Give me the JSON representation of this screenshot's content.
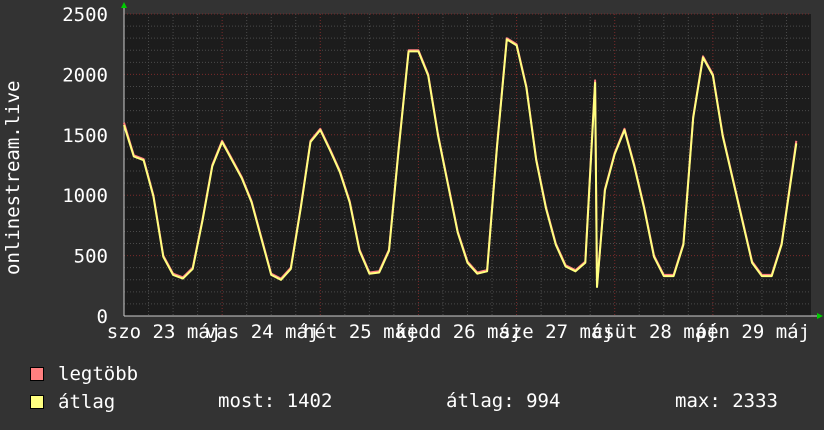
{
  "chart_data": {
    "type": "line",
    "ylabel": "onlinestream.live",
    "ylim": [
      0,
      2500
    ],
    "yticks": [
      0,
      500,
      1000,
      1500,
      2000,
      2500
    ],
    "x_tick_labels": [
      "szo 23 máj",
      "vas 24 máj",
      "hét 25 máj",
      "kedd 26 máj",
      "sze 27 máj",
      "csüt 28 máj",
      "pén 29 máj"
    ],
    "grid": true,
    "colors": {
      "background": "#333333",
      "plot": "#1c1c1c",
      "grid_major": "#7a2a2a",
      "grid_minor": "#4a4a4a",
      "max": "#ff8080",
      "avg": "#ffff80",
      "axis_arrow": "#00cc00"
    },
    "series": [
      {
        "name": "legtöbb",
        "color": "#ff8080",
        "values": [
          [
            0,
            1600
          ],
          [
            0.1,
            1330
          ],
          [
            0.2,
            1300
          ],
          [
            0.3,
            1000
          ],
          [
            0.4,
            500
          ],
          [
            0.5,
            350
          ],
          [
            0.6,
            320
          ],
          [
            0.7,
            400
          ],
          [
            0.8,
            800
          ],
          [
            0.9,
            1250
          ],
          [
            1.0,
            1450
          ],
          [
            1.1,
            1300
          ],
          [
            1.2,
            1150
          ],
          [
            1.3,
            950
          ],
          [
            1.4,
            650
          ],
          [
            1.5,
            350
          ],
          [
            1.6,
            310
          ],
          [
            1.7,
            400
          ],
          [
            1.8,
            900
          ],
          [
            1.9,
            1450
          ],
          [
            2.0,
            1550
          ],
          [
            2.1,
            1380
          ],
          [
            2.2,
            1200
          ],
          [
            2.3,
            950
          ],
          [
            2.4,
            550
          ],
          [
            2.5,
            360
          ],
          [
            2.6,
            370
          ],
          [
            2.7,
            550
          ],
          [
            2.8,
            1400
          ],
          [
            2.9,
            2200
          ],
          [
            3.0,
            2200
          ],
          [
            3.1,
            2000
          ],
          [
            3.2,
            1500
          ],
          [
            3.3,
            1100
          ],
          [
            3.4,
            700
          ],
          [
            3.5,
            450
          ],
          [
            3.6,
            360
          ],
          [
            3.7,
            380
          ],
          [
            3.8,
            1400
          ],
          [
            3.9,
            2300
          ],
          [
            4.0,
            2250
          ],
          [
            4.1,
            1900
          ],
          [
            4.2,
            1300
          ],
          [
            4.3,
            900
          ],
          [
            4.4,
            600
          ],
          [
            4.5,
            420
          ],
          [
            4.6,
            380
          ],
          [
            4.7,
            450
          ],
          [
            4.8,
            1950
          ],
          [
            4.82,
            250
          ],
          [
            4.9,
            1050
          ],
          [
            5.0,
            1350
          ],
          [
            5.1,
            1550
          ],
          [
            5.2,
            1250
          ],
          [
            5.3,
            900
          ],
          [
            5.4,
            500
          ],
          [
            5.5,
            340
          ],
          [
            5.6,
            340
          ],
          [
            5.7,
            600
          ],
          [
            5.8,
            1650
          ],
          [
            5.9,
            2150
          ],
          [
            6.0,
            2000
          ],
          [
            6.1,
            1500
          ],
          [
            6.2,
            1150
          ],
          [
            6.3,
            800
          ],
          [
            6.4,
            450
          ],
          [
            6.5,
            340
          ],
          [
            6.6,
            340
          ],
          [
            6.7,
            600
          ],
          [
            6.85,
            1450
          ]
        ]
      },
      {
        "name": "átlag",
        "color": "#ffff80",
        "values": [
          [
            0,
            1580
          ],
          [
            0.1,
            1320
          ],
          [
            0.2,
            1290
          ],
          [
            0.3,
            990
          ],
          [
            0.4,
            490
          ],
          [
            0.5,
            340
          ],
          [
            0.6,
            310
          ],
          [
            0.7,
            390
          ],
          [
            0.8,
            790
          ],
          [
            0.9,
            1240
          ],
          [
            1.0,
            1440
          ],
          [
            1.1,
            1290
          ],
          [
            1.2,
            1140
          ],
          [
            1.3,
            940
          ],
          [
            1.4,
            640
          ],
          [
            1.5,
            340
          ],
          [
            1.6,
            300
          ],
          [
            1.7,
            390
          ],
          [
            1.8,
            890
          ],
          [
            1.9,
            1440
          ],
          [
            2.0,
            1540
          ],
          [
            2.1,
            1370
          ],
          [
            2.2,
            1190
          ],
          [
            2.3,
            940
          ],
          [
            2.4,
            540
          ],
          [
            2.5,
            350
          ],
          [
            2.6,
            360
          ],
          [
            2.7,
            540
          ],
          [
            2.8,
            1390
          ],
          [
            2.9,
            2190
          ],
          [
            3.0,
            2190
          ],
          [
            3.1,
            1990
          ],
          [
            3.2,
            1490
          ],
          [
            3.3,
            1090
          ],
          [
            3.4,
            690
          ],
          [
            3.5,
            440
          ],
          [
            3.6,
            350
          ],
          [
            3.7,
            370
          ],
          [
            3.8,
            1390
          ],
          [
            3.9,
            2290
          ],
          [
            4.0,
            2240
          ],
          [
            4.1,
            1890
          ],
          [
            4.2,
            1290
          ],
          [
            4.3,
            890
          ],
          [
            4.4,
            590
          ],
          [
            4.5,
            410
          ],
          [
            4.6,
            370
          ],
          [
            4.7,
            440
          ],
          [
            4.8,
            1930
          ],
          [
            4.82,
            240
          ],
          [
            4.9,
            1040
          ],
          [
            5.0,
            1340
          ],
          [
            5.1,
            1540
          ],
          [
            5.2,
            1240
          ],
          [
            5.3,
            890
          ],
          [
            5.4,
            490
          ],
          [
            5.5,
            330
          ],
          [
            5.6,
            330
          ],
          [
            5.7,
            590
          ],
          [
            5.8,
            1640
          ],
          [
            5.9,
            2140
          ],
          [
            6.0,
            1990
          ],
          [
            6.1,
            1490
          ],
          [
            6.2,
            1140
          ],
          [
            6.3,
            790
          ],
          [
            6.4,
            440
          ],
          [
            6.5,
            330
          ],
          [
            6.6,
            330
          ],
          [
            6.7,
            590
          ],
          [
            6.85,
            1430
          ]
        ]
      }
    ]
  },
  "legend": {
    "max_label": "legtöbb",
    "avg_label": "átlag"
  },
  "stats": {
    "now": "most: 1402",
    "avg": "átlag: 994",
    "max": "max: 2333"
  }
}
